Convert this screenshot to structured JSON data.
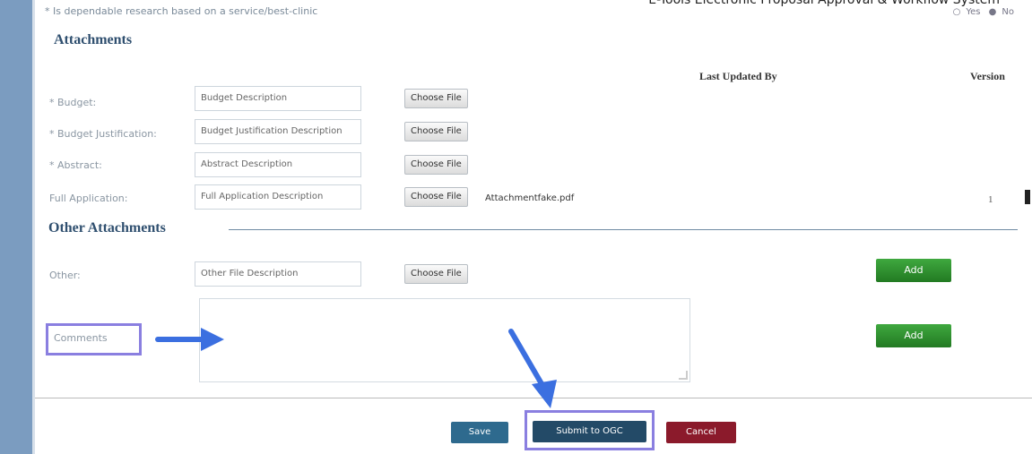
{
  "header": {
    "system_title": "E-Tools Electronic Proposal Approval & Workflow System",
    "question_text": "* Is dependable research based on a service/best-clinic",
    "yes_label": "Yes",
    "no_label": "No"
  },
  "attachments": {
    "heading": "Attachments",
    "col_last_updated": "Last Updated By",
    "col_version": "Version",
    "rows": [
      {
        "label": "* Budget:",
        "value": "Budget Description",
        "button": "Choose File"
      },
      {
        "label": "* Budget Justification:",
        "value": "Budget Justification Description",
        "button": "Choose File"
      },
      {
        "label": "* Abstract:",
        "value": "Abstract Description",
        "button": "Choose File"
      },
      {
        "label": "Full Application:",
        "value": "Full Application Description",
        "button": "Choose File",
        "file": "Attachmentfake.pdf",
        "version": "1"
      }
    ]
  },
  "other": {
    "heading": "Other Attachments",
    "other_label": "Other:",
    "other_value": "Other File Description",
    "other_button": "Choose File",
    "add_label": "Add",
    "comments_label": "Comments",
    "comments_value": ""
  },
  "actions": {
    "save": "Save",
    "submit": "Submit to OGC",
    "cancel": "Cancel"
  },
  "colors": {
    "save": "#2e6a8e",
    "submit": "#234a67",
    "cancel": "#8b1a2b",
    "highlight": "#8a7fe0",
    "arrow": "#3b6fe0"
  }
}
